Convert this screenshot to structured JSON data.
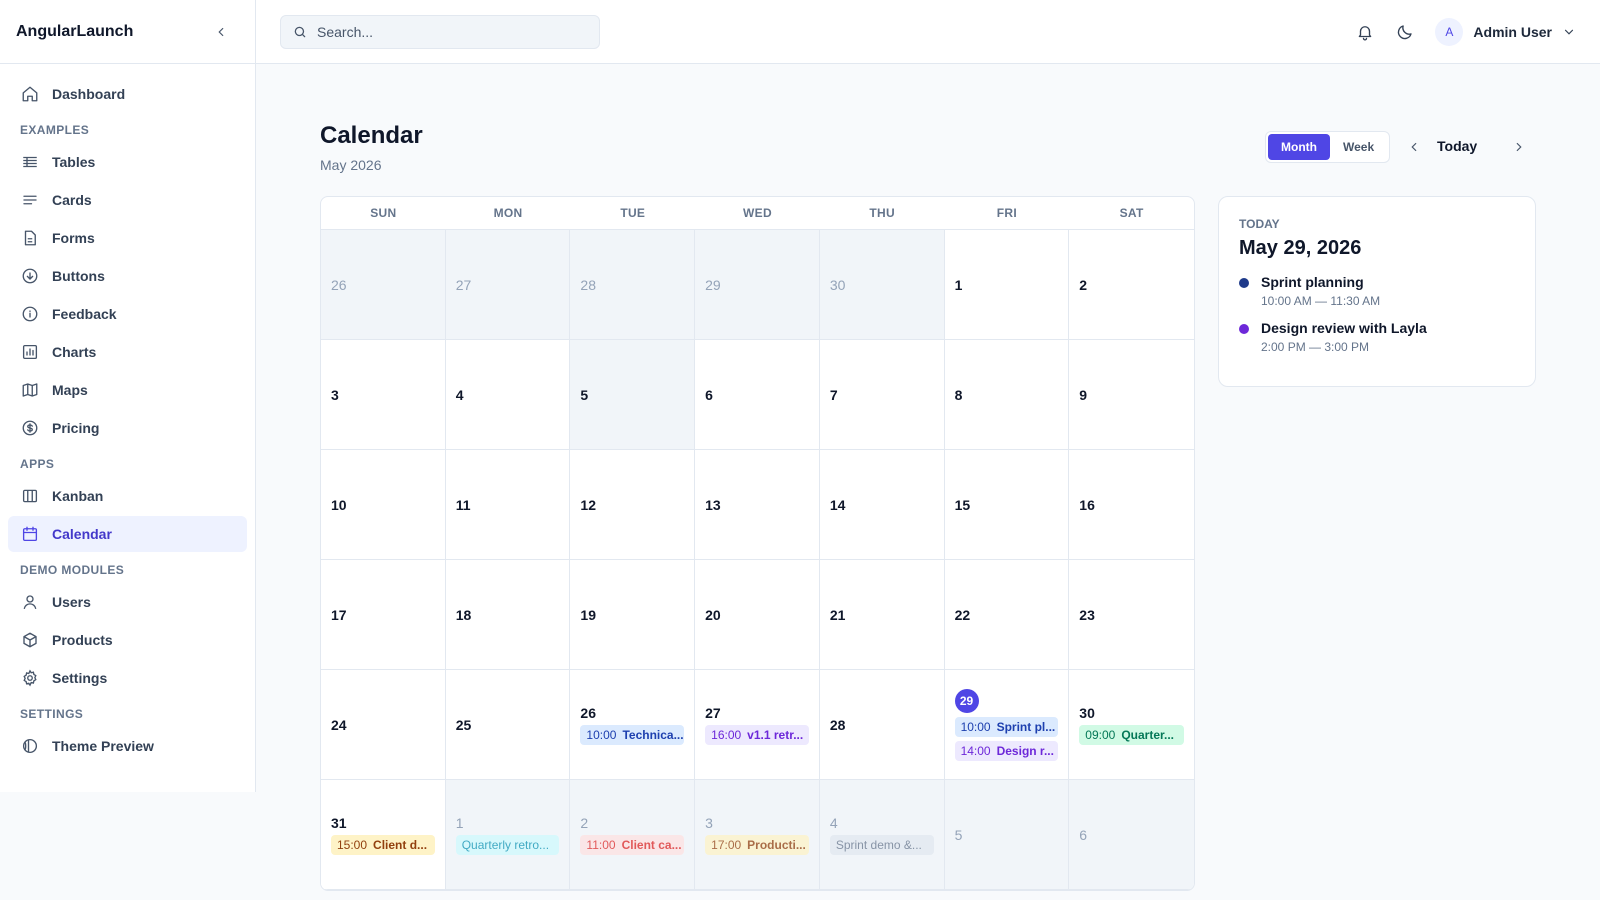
{
  "brand": "AngularLaunch",
  "sidebar": {
    "items": [
      {
        "label": "Dashboard"
      },
      {
        "section": "EXAMPLES"
      },
      {
        "label": "Tables"
      },
      {
        "label": "Cards"
      },
      {
        "label": "Forms"
      },
      {
        "label": "Buttons"
      },
      {
        "label": "Feedback"
      },
      {
        "label": "Charts"
      },
      {
        "label": "Maps"
      },
      {
        "label": "Pricing"
      },
      {
        "section": "APPS"
      },
      {
        "label": "Kanban"
      },
      {
        "label": "Calendar"
      },
      {
        "section": "DEMO MODULES"
      },
      {
        "label": "Users"
      },
      {
        "label": "Products"
      },
      {
        "label": "Settings"
      },
      {
        "section": "SETTINGS"
      },
      {
        "label": "Theme Preview"
      }
    ]
  },
  "header": {
    "search_placeholder": "Search...",
    "user_initial": "A",
    "user_name": "Admin User"
  },
  "page": {
    "title": "Calendar",
    "subtitle": "May 2026",
    "view_month": "Month",
    "view_week": "Week",
    "today": "Today"
  },
  "calendar": {
    "weekdays": [
      "SUN",
      "MON",
      "TUE",
      "WED",
      "THU",
      "FRI",
      "SAT"
    ],
    "cells": [
      {
        "day": "26",
        "muted": true
      },
      {
        "day": "27",
        "muted": true
      },
      {
        "day": "28",
        "muted": true
      },
      {
        "day": "29",
        "muted": true
      },
      {
        "day": "30",
        "muted": true
      },
      {
        "day": "1"
      },
      {
        "day": "2"
      },
      {
        "day": "3"
      },
      {
        "day": "4"
      },
      {
        "day": "5",
        "shaded": true
      },
      {
        "day": "6"
      },
      {
        "day": "7"
      },
      {
        "day": "8"
      },
      {
        "day": "9"
      },
      {
        "day": "10"
      },
      {
        "day": "11"
      },
      {
        "day": "12"
      },
      {
        "day": "13"
      },
      {
        "day": "14"
      },
      {
        "day": "15"
      },
      {
        "day": "16"
      },
      {
        "day": "17"
      },
      {
        "day": "18"
      },
      {
        "day": "19"
      },
      {
        "day": "20"
      },
      {
        "day": "21"
      },
      {
        "day": "22"
      },
      {
        "day": "23"
      },
      {
        "day": "24"
      },
      {
        "day": "25"
      },
      {
        "day": "26",
        "events": [
          {
            "time": "10:00",
            "title": "Technica...",
            "color": "blue"
          }
        ]
      },
      {
        "day": "27",
        "events": [
          {
            "time": "16:00",
            "title": "v1.1 retr...",
            "color": "purple"
          }
        ]
      },
      {
        "day": "28"
      },
      {
        "day": "29",
        "today": true,
        "events": [
          {
            "time": "10:00",
            "title": "Sprint pl...",
            "color": "blue"
          },
          {
            "time": "14:00",
            "title": "Design r...",
            "color": "purple"
          }
        ]
      },
      {
        "day": "30",
        "events": [
          {
            "time": "09:00",
            "title": "Quarter...",
            "color": "green"
          }
        ]
      },
      {
        "day": "31",
        "events": [
          {
            "time": "15:00",
            "title": "Client d...",
            "color": "amber"
          }
        ]
      },
      {
        "day": "1",
        "muted": true,
        "events": [
          {
            "time": "",
            "title": "Quarterly retro...",
            "color": "cyan"
          }
        ]
      },
      {
        "day": "2",
        "muted": true,
        "events": [
          {
            "time": "11:00",
            "title": "Client ca...",
            "color": "red"
          }
        ]
      },
      {
        "day": "3",
        "muted": true,
        "events": [
          {
            "time": "17:00",
            "title": "Producti...",
            "color": "amber"
          }
        ]
      },
      {
        "day": "4",
        "muted": true,
        "events": [
          {
            "time": "",
            "title": "Sprint demo &...",
            "color": "gray"
          }
        ]
      },
      {
        "day": "5",
        "muted": true
      },
      {
        "day": "6",
        "muted": true
      }
    ]
  },
  "agenda": {
    "label": "TODAY",
    "date": "May 29, 2026",
    "items": [
      {
        "title": "Sprint planning",
        "time": "10:00 AM — 11:30 AM",
        "color": "#1e3a8a"
      },
      {
        "title": "Design review with Layla",
        "time": "2:00 PM — 3:00 PM",
        "color": "#6d28d9"
      }
    ]
  },
  "colors": {
    "accent": "#4f46e5",
    "active_bg": "#eef2ff"
  }
}
